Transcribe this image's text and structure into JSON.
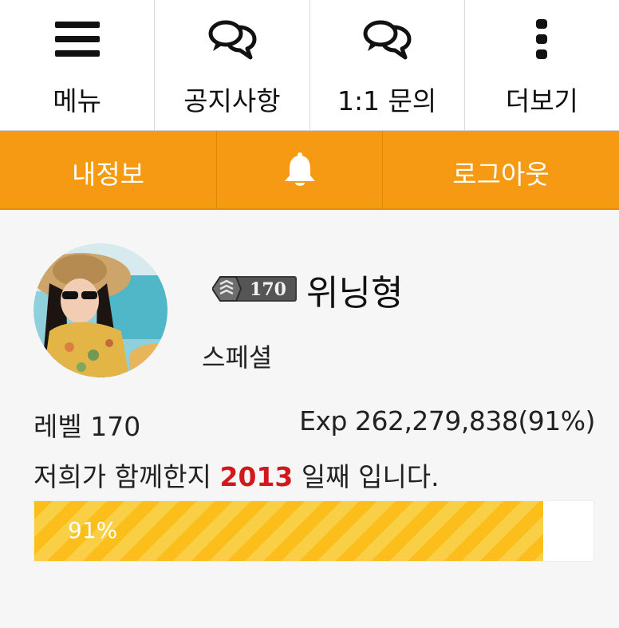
{
  "top_nav": {
    "items": [
      {
        "label": "메뉴",
        "icon": "hamburger-menu-icon"
      },
      {
        "label": "공지사항",
        "icon": "chat-bubbles-icon"
      },
      {
        "label": "1:1 문의",
        "icon": "chat-bubbles-icon"
      },
      {
        "label": "더보기",
        "icon": "vertical-dots-icon"
      }
    ]
  },
  "action_bar": {
    "color": "#f59a12",
    "my_info_label": "내정보",
    "bell_icon": "bell-icon",
    "logout_label": "로그아웃"
  },
  "profile": {
    "level_badge": "170",
    "nickname": "위닝형",
    "grade": "스페셜",
    "level_text": "레벨 170",
    "exp_text": "Exp 262,279,838(91%)",
    "days_prefix": "저희가 함께한지",
    "days_count": "2013",
    "days_suffix": "일째 입니다.",
    "days_color": "#d2181c",
    "progress": {
      "percent": 91,
      "label": "91%",
      "color": "#fbbe1a"
    }
  }
}
